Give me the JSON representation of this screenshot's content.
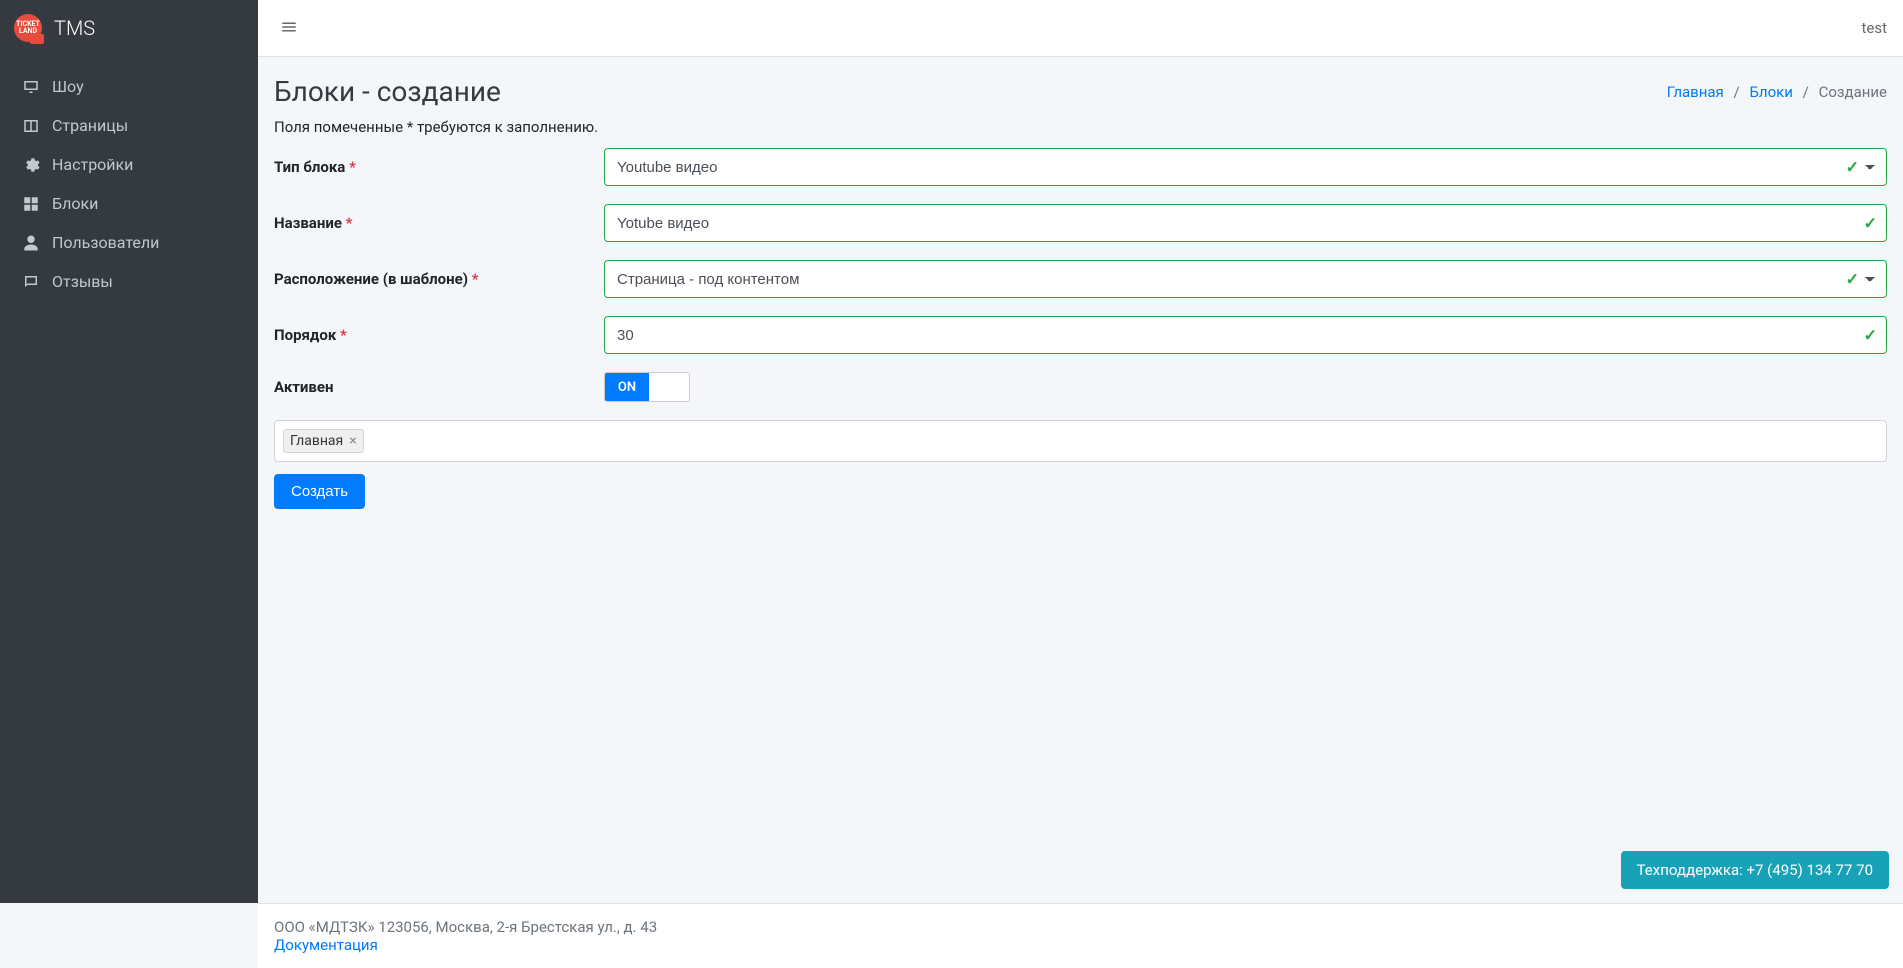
{
  "brand": {
    "name": "TMS",
    "logo_text": "TICKET LAND"
  },
  "topbar": {
    "user": "test"
  },
  "sidebar": {
    "items": [
      {
        "label": "Шоу",
        "icon": "monitor"
      },
      {
        "label": "Страницы",
        "icon": "columns"
      },
      {
        "label": "Настройки",
        "icon": "gear"
      },
      {
        "label": "Блоки",
        "icon": "grid"
      },
      {
        "label": "Пользователи",
        "icon": "user"
      },
      {
        "label": "Отзывы",
        "icon": "chat"
      }
    ]
  },
  "header": {
    "title": "Блоки - создание",
    "breadcrumb": [
      {
        "label": "Главная",
        "link": true
      },
      {
        "label": "Блоки",
        "link": true
      },
      {
        "label": "Создание",
        "link": false
      }
    ]
  },
  "form": {
    "hint": "Поля помеченные * требуются к заполнению.",
    "fields": {
      "block_type": {
        "label": "Тип блока",
        "required": true,
        "value": "Youtube видео"
      },
      "name": {
        "label": "Название",
        "required": true,
        "value": "Yotube видео"
      },
      "placement": {
        "label": "Расположение (в шаблоне)",
        "required": true,
        "value": "Страница - под контентом"
      },
      "order": {
        "label": "Порядок",
        "required": true,
        "value": "30"
      },
      "active": {
        "label": "Активен",
        "on_label": "ON",
        "value": true
      }
    },
    "tags": [
      "Главная"
    ],
    "submit_label": "Создать"
  },
  "footer": {
    "address": "ООО «МДТЗК» 123056, Москва, 2-я Брестская ул., д. 43",
    "doc_label": "Документация"
  },
  "support": {
    "label": "Техподдержка: +7 (495) 134 77 70"
  }
}
